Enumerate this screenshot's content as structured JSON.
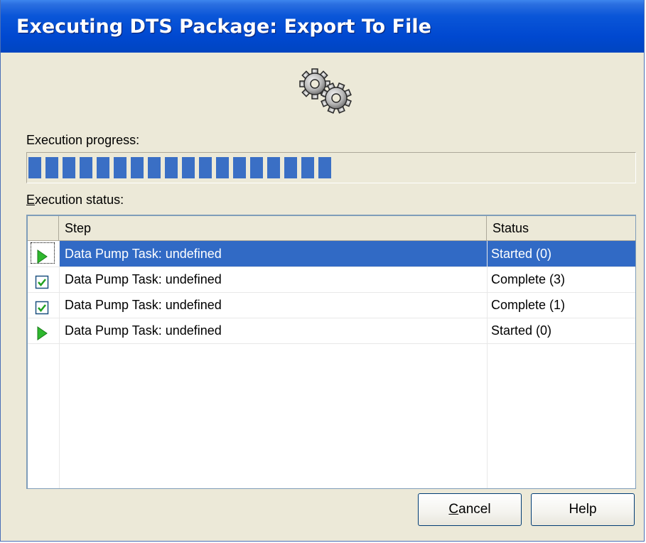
{
  "window": {
    "title": "Executing DTS Package: Export To File"
  },
  "icons": {
    "header": "gears-icon",
    "running": "play-arrow-icon",
    "done": "checkbox-checked-icon"
  },
  "colors": {
    "titlebar": "#0a56d8",
    "progress_fill": "#3a6fc5",
    "selection": "#316ac5",
    "running_icon": "#2eb82e"
  },
  "progress": {
    "label": "Execution progress:",
    "fraction": 0.5
  },
  "status": {
    "label_accel": "E",
    "label_rest": "xecution status:",
    "columns": {
      "step": "Step",
      "status": "Status"
    },
    "rows": [
      {
        "icon": "play-arrow-icon",
        "step": "Data Pump Task: undefined",
        "status": "Started (0)",
        "selected": true
      },
      {
        "icon": "checkbox-checked-icon",
        "step": "Data Pump Task: undefined",
        "status": "Complete (3)",
        "selected": false
      },
      {
        "icon": "checkbox-checked-icon",
        "step": "Data Pump Task: undefined",
        "status": "Complete (1)",
        "selected": false
      },
      {
        "icon": "play-arrow-icon",
        "step": "Data Pump Task: undefined",
        "status": "Started (0)",
        "selected": false
      }
    ]
  },
  "buttons": {
    "cancel_accel": "C",
    "cancel_rest": "ancel",
    "help": "Help"
  }
}
